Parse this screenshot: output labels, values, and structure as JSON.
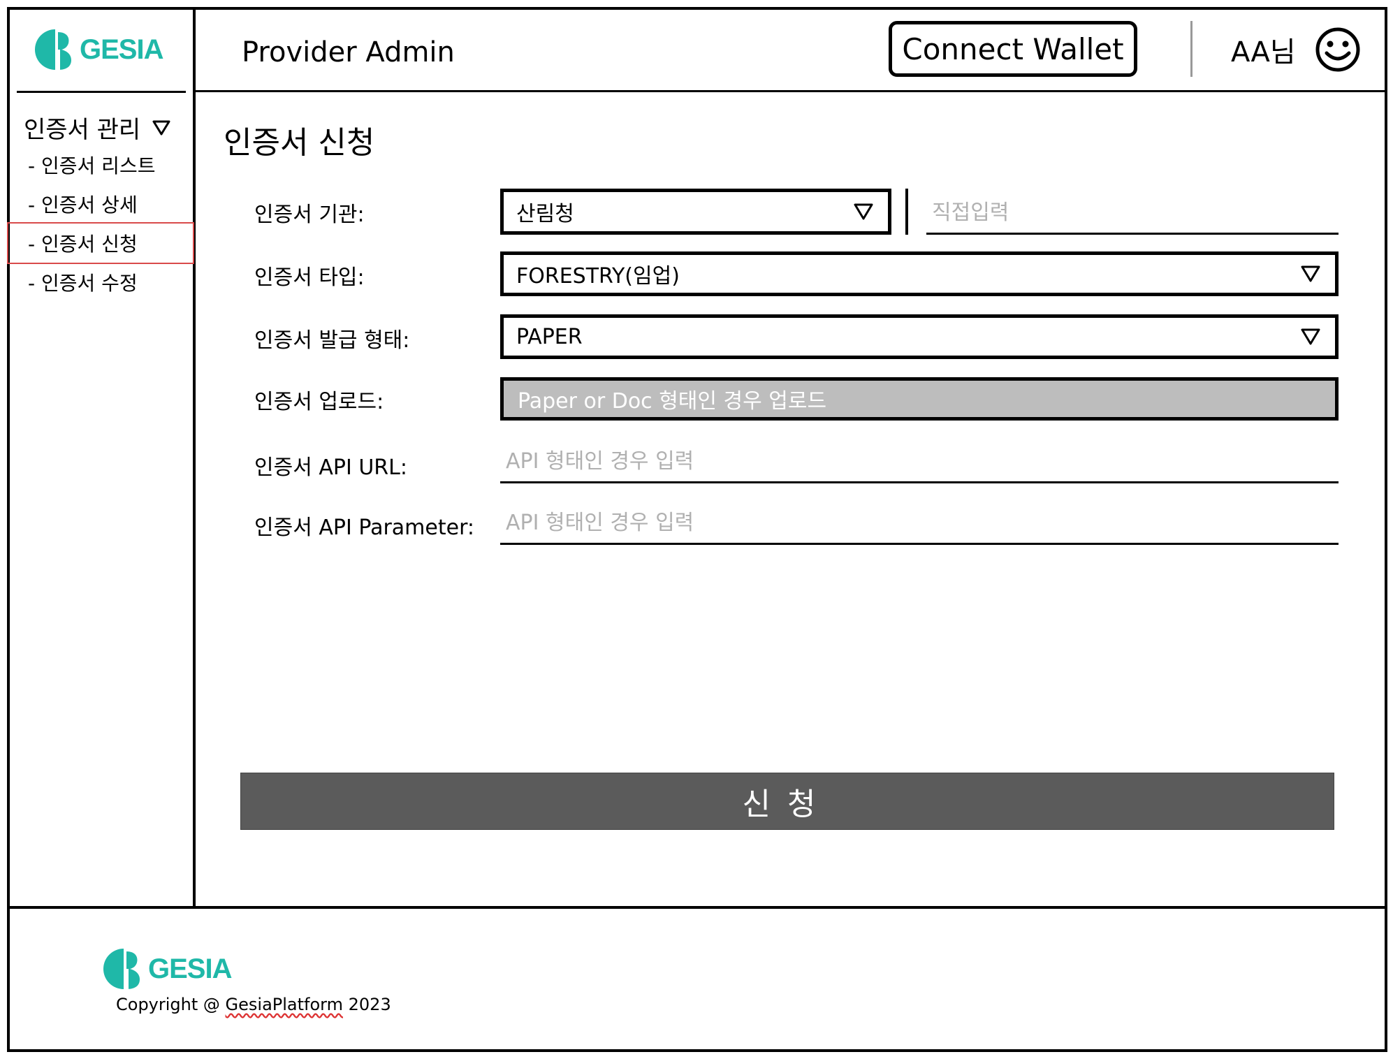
{
  "brand": {
    "logo_text": "GESIA",
    "accent_color": "#1fb8a8"
  },
  "header": {
    "title": "Provider Admin",
    "connect_wallet_label": "Connect Wallet",
    "user_name": "AA님",
    "user_icon": "smiley-icon"
  },
  "sidebar": {
    "group_label": "인증서 관리",
    "group_icon": "triangle-down-icon",
    "items": [
      {
        "label": "- 인증서 리스트"
      },
      {
        "label": "- 인증서 상세"
      },
      {
        "label": "- 인증서 신청",
        "active": true
      },
      {
        "label": "- 인증서 수정"
      }
    ]
  },
  "main": {
    "page_title": "인증서 신청",
    "form": {
      "agency": {
        "label": "인증서 기관:",
        "value": "산림청",
        "direct_input_placeholder": "직접입력"
      },
      "type": {
        "label": "인증서 타입:",
        "value": "FORESTRY(임업)"
      },
      "issue_form": {
        "label": "인증서 발급 형태:",
        "value": "PAPER"
      },
      "upload": {
        "label": "인증서 업로드:",
        "placeholder": "Paper or Doc 형태인 경우 업로드"
      },
      "api_url": {
        "label": "인증서 API URL:",
        "placeholder": "API 형태인 경우 입력"
      },
      "api_parameter": {
        "label": "인증서 API Parameter:",
        "placeholder": "API 형태인 경우 입력"
      }
    },
    "submit_label": "신청"
  },
  "footer": {
    "logo_text": "GESIA",
    "copyright_prefix": "Copyright @ ",
    "copyright_brand": "GesiaPlatform",
    "copyright_year": " 2023"
  }
}
